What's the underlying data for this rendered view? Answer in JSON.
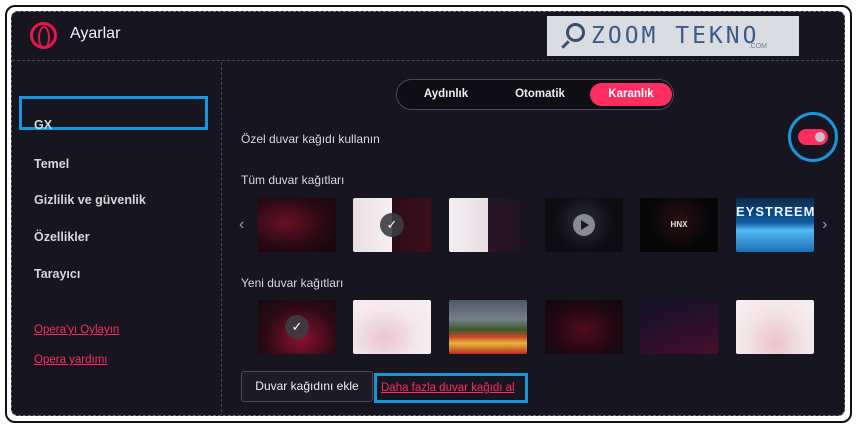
{
  "window": {
    "title": "Ayarlar"
  },
  "watermark": {
    "text": "ZOOM TEKNO",
    "sub": ".COM"
  },
  "sidebar": {
    "items": [
      {
        "label": "GX"
      },
      {
        "label": "Temel"
      },
      {
        "label": "Gizlilik ve güvenlik"
      },
      {
        "label": "Özellikler"
      },
      {
        "label": "Tarayıcı"
      }
    ],
    "links": [
      {
        "label": "Opera'yı Oylayın"
      },
      {
        "label": "Opera yardımı"
      }
    ]
  },
  "theme": {
    "options": [
      {
        "label": "Aydınlık"
      },
      {
        "label": "Otomatik"
      },
      {
        "label": "Karanlık"
      }
    ],
    "selected": "Karanlık"
  },
  "custom_wallpaper": {
    "label": "Özel duvar kağıdı kullanın",
    "enabled": true
  },
  "all_wallpapers": {
    "label": "Tüm duvar kağıtları"
  },
  "new_wallpapers": {
    "label": "Yeni duvar kağıtları"
  },
  "thumbnails": {
    "thumb_text_5": "HNX",
    "thumb_text_6": "EYSTREEM"
  },
  "icons": {
    "check": "✓",
    "left": "‹",
    "right": "›"
  },
  "actions": {
    "add_wallpaper": "Duvar kağıdını ekle",
    "get_more": "Daha fazla duvar kağıdı al"
  },
  "colors": {
    "accent": "#ff2d62",
    "highlight": "#1996d8",
    "background": "#17151f"
  }
}
